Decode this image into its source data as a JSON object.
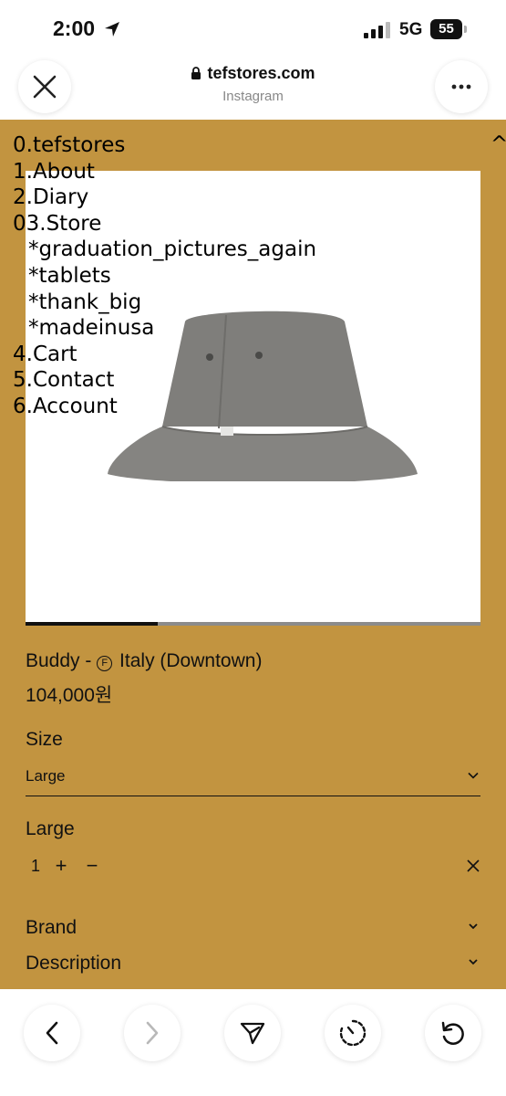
{
  "status_bar": {
    "time": "2:00",
    "network": "5G",
    "battery": "55"
  },
  "browser": {
    "url": "tefstores.com",
    "source": "Instagram"
  },
  "site": {
    "nav": {
      "items": [
        "0.tefstores",
        "1.About",
        "2.Diary",
        "03.Store",
        "*graduation_pictures_again",
        "*tablets",
        "*thank_big",
        "*madeinusa",
        "4.Cart",
        "5.Contact",
        "6.Account"
      ],
      "corner_label": "^I"
    },
    "product": {
      "name_prefix": "Buddy - ",
      "brand_mark": "F",
      "name_suffix": " Italy (Downtown)",
      "price": "104,000원",
      "size_label": "Size",
      "size_value": "Large",
      "line_item_label": "Large",
      "quantity": "1",
      "plus": "+",
      "minus": "−",
      "image_progress": 0.29
    },
    "accordions": {
      "brand": "Brand",
      "description": "Description"
    }
  },
  "colors": {
    "page_background": "#c29440"
  }
}
